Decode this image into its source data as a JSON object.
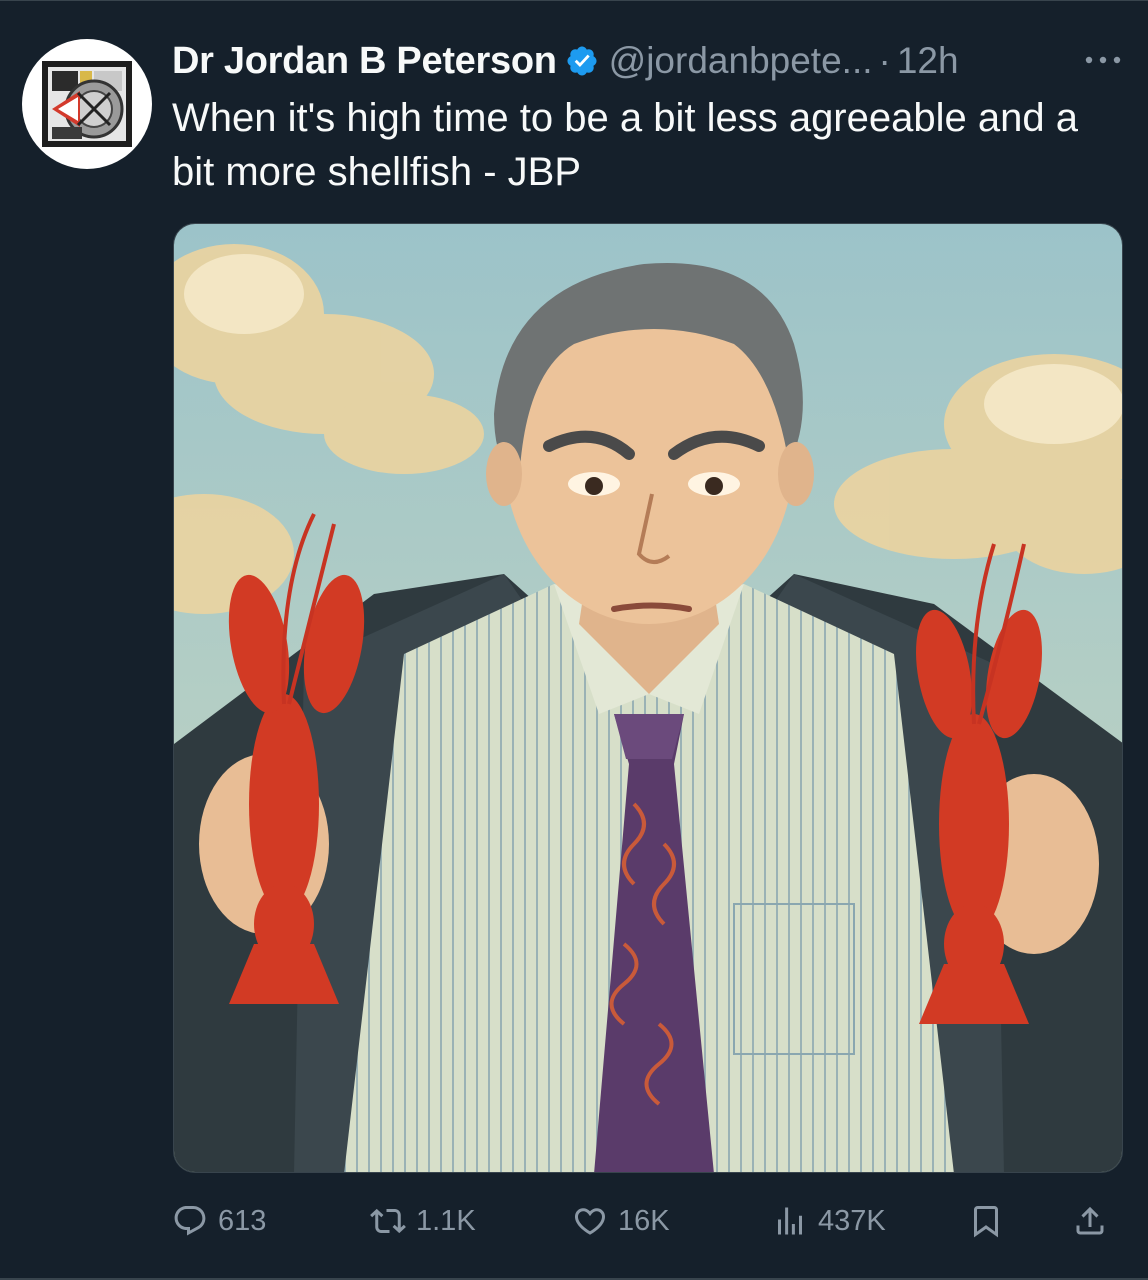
{
  "tweet": {
    "author_name": "Dr Jordan B Peterson",
    "handle": "@jordanbpete...",
    "separator": "·",
    "time": "12h",
    "text": "When it's high time to be a bit less agreeable and a bit more shellfish - JBP"
  },
  "icons": {
    "verified": "verified-badge-icon",
    "more": "more-options-icon",
    "reply": "reply-icon",
    "retweet": "retweet-icon",
    "like": "heart-icon",
    "views": "views-icon",
    "bookmark": "bookmark-icon",
    "share": "share-icon"
  },
  "actions": {
    "replies": "613",
    "retweets": "1.1K",
    "likes": "16K",
    "views": "437K"
  },
  "colors": {
    "background": "#15202b",
    "text": "#f7f9f9",
    "secondary": "#8b98a5",
    "verified": "#1d9bf0",
    "border": "#38444d"
  }
}
